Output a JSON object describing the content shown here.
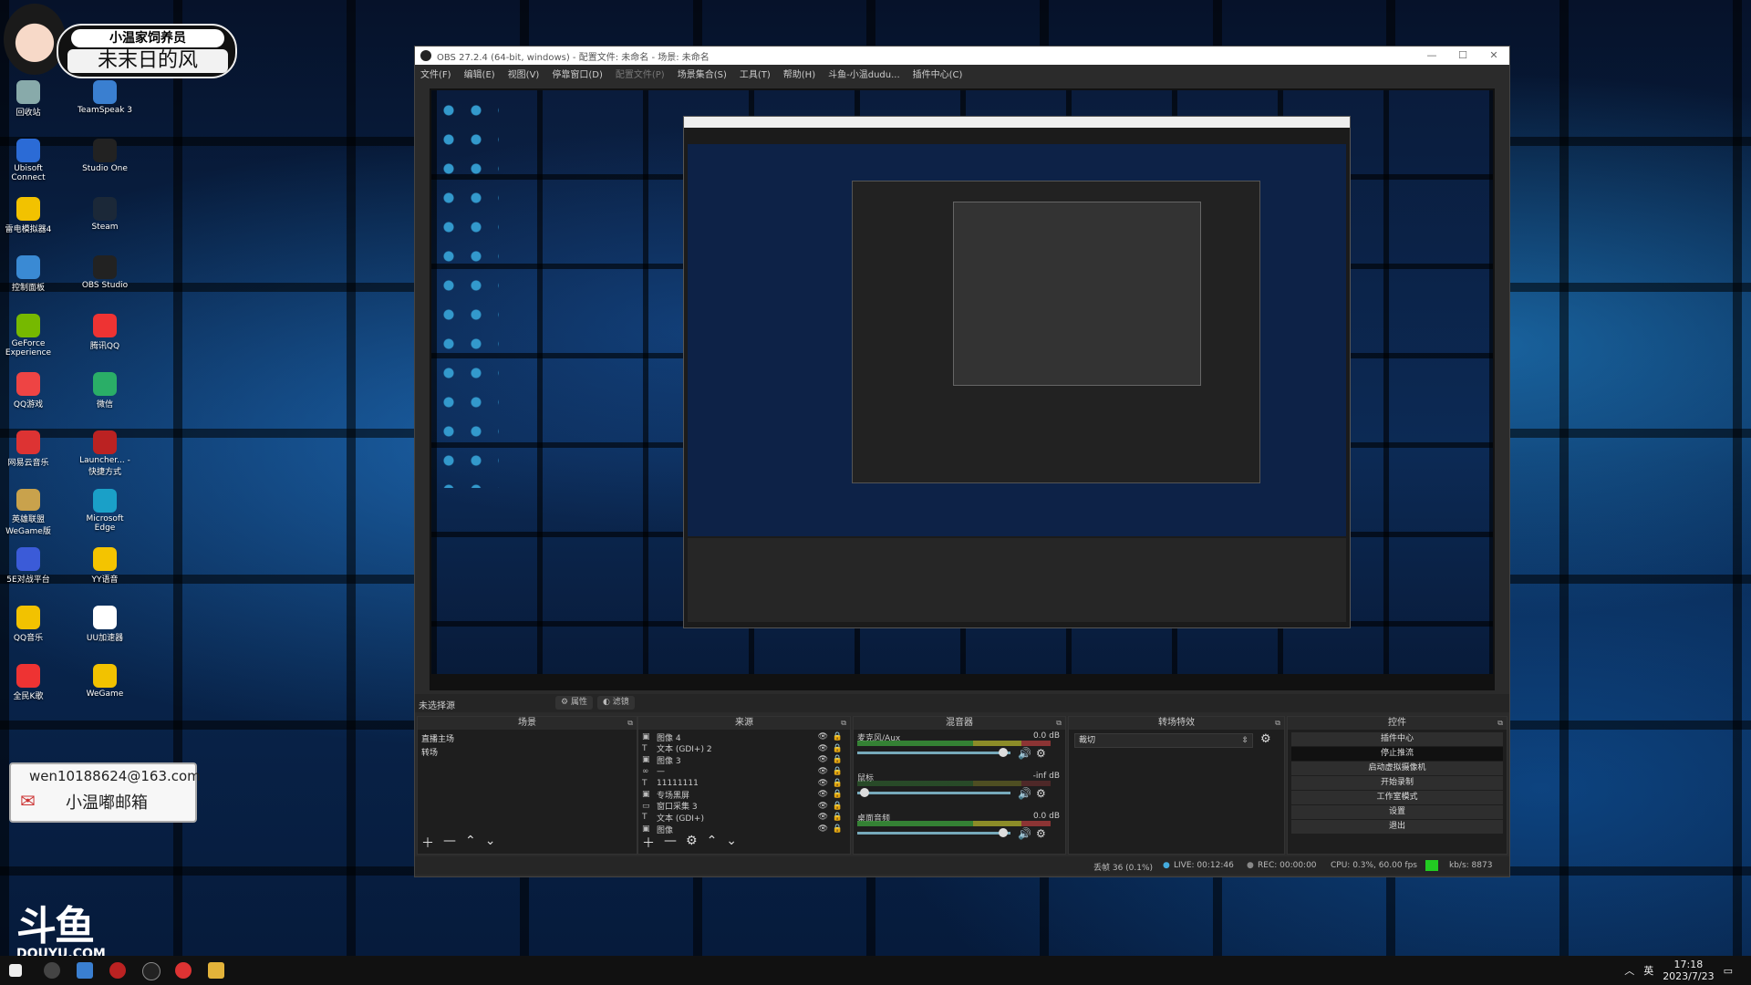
{
  "desktop": {
    "badge_top": "小温家饲养员",
    "badge_bottom": "未末日的风",
    "icons": [
      {
        "label": "回收站",
        "icon": "recycle-bin-icon",
        "color": "#8aa"
      },
      {
        "label": "TeamSpeak 3",
        "icon": "teamspeak-icon",
        "color": "#3a7fd0"
      },
      {
        "label": "Ubisoft Connect",
        "icon": "ubisoft-icon",
        "color": "#2b6bd6"
      },
      {
        "label": "Studio One",
        "icon": "studio-one-icon",
        "color": "#222"
      },
      {
        "label": "雷电模拟器4",
        "icon": "ldplayer-icon",
        "color": "#f2c200"
      },
      {
        "label": "Steam",
        "icon": "steam-icon",
        "color": "#1b2838"
      },
      {
        "label": "控制面板",
        "icon": "control-panel-icon",
        "color": "#3a8ad4"
      },
      {
        "label": "OBS Studio",
        "icon": "obs-icon",
        "color": "#222"
      },
      {
        "label": "GeForce Experience",
        "icon": "geforce-icon",
        "color": "#76b900"
      },
      {
        "label": "腾讯QQ",
        "icon": "qq-icon",
        "color": "#e33"
      },
      {
        "label": "QQ游戏",
        "icon": "qq-game-icon",
        "color": "#e44"
      },
      {
        "label": "微信",
        "icon": "wechat-icon",
        "color": "#2aae67"
      },
      {
        "label": "网易云音乐",
        "icon": "netease-music-icon",
        "color": "#d33"
      },
      {
        "label": "Launcher... - 快捷方式",
        "icon": "launcher-icon",
        "color": "#b22"
      },
      {
        "label": "英雄联盟WeGame版",
        "icon": "lol-icon",
        "color": "#c9a24c"
      },
      {
        "label": "Microsoft Edge",
        "icon": "edge-icon",
        "color": "#1aa0c8"
      },
      {
        "label": "5E对战平台",
        "icon": "5e-icon",
        "color": "#3b5bd8"
      },
      {
        "label": "YY语音",
        "icon": "yy-icon",
        "color": "#f4c400"
      },
      {
        "label": "QQ音乐",
        "icon": "qq-music-icon",
        "color": "#f2c200"
      },
      {
        "label": "UU加速器",
        "icon": "uu-icon",
        "color": "#fff"
      },
      {
        "label": "全民K歌",
        "icon": "kge-icon",
        "color": "#e33"
      },
      {
        "label": "WeGame",
        "icon": "wegame-icon",
        "color": "#f2c200"
      }
    ],
    "email_line": "wen10188624@163.com",
    "email_sub": "小温嘟邮箱",
    "douyu_text": "斗鱼",
    "douyu_domain": "DOUYU.COM"
  },
  "taskbar": {
    "ime": "英",
    "time": "17:18",
    "date": "2023/7/23"
  },
  "obs": {
    "title": "OBS 27.2.4 (64-bit, windows) - 配置文件: 未命名 - 场景: 未命名",
    "menu": [
      "文件(F)",
      "编辑(E)",
      "视图(V)",
      "停靠窗口(D)",
      "配置文件(P)",
      "场景集合(S)",
      "工具(T)",
      "帮助(H)",
      "斗鱼-小温dudu...",
      "插件中心(C)"
    ],
    "scene_header": "未选择源",
    "props_btn": "属性",
    "filters_btn": "滤镜",
    "docks": {
      "scenes": {
        "title": "场景",
        "items": [
          "直播主场",
          "转场"
        ]
      },
      "sources": {
        "title": "来源",
        "items": [
          {
            "icon": "▣",
            "name": "图像 4"
          },
          {
            "icon": "T",
            "name": "文本 (GDI+) 2"
          },
          {
            "icon": "▣",
            "name": "图像 3"
          },
          {
            "icon": "∞",
            "name": "—"
          },
          {
            "icon": "T",
            "name": "11111111"
          },
          {
            "icon": "▣",
            "name": "专场黑屏"
          },
          {
            "icon": "▭",
            "name": "窗口采集 3"
          },
          {
            "icon": "T",
            "name": "文本 (GDI+)"
          },
          {
            "icon": "▣",
            "name": "图像"
          }
        ]
      },
      "mixer": {
        "title": "混音器",
        "channels": [
          {
            "name": "麦克风/Aux",
            "db": "0.0 dB",
            "level": 0.95
          },
          {
            "name": "鼠标",
            "db": "-inf dB",
            "level": 0.05
          },
          {
            "name": "桌面音频",
            "db": "0.0 dB",
            "level": 0.95
          }
        ]
      },
      "transitions": {
        "title": "转场特效",
        "selected": "裁切"
      },
      "controls": {
        "title": "控件",
        "buttons": [
          "插件中心",
          "停止推流",
          "启动虚拟摄像机",
          "开始录制",
          "工作室模式",
          "设置",
          "退出"
        ]
      }
    },
    "status": {
      "dropped": "丢帧 36 (0.1%)",
      "live": "LIVE: 00:12:46",
      "rec": "REC: 00:00:00",
      "cpu": "CPU: 0.3%, 60.00 fps",
      "kbps": "kb/s: 8873"
    }
  }
}
